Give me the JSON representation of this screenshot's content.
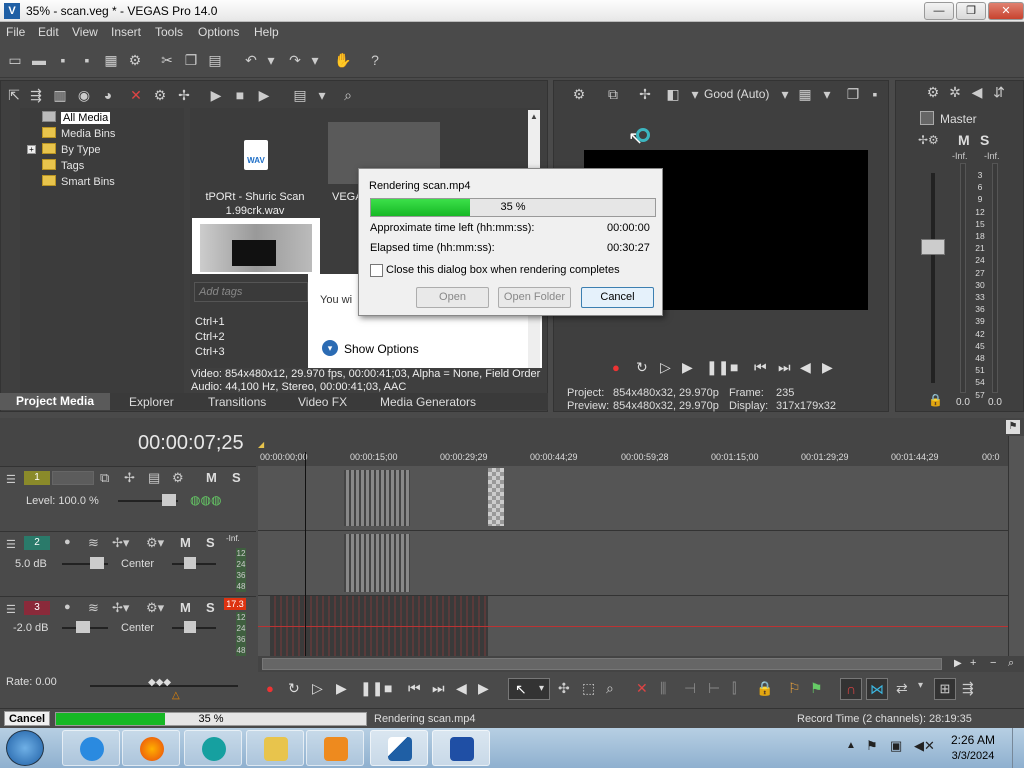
{
  "window": {
    "title": "35% - scan.veg * - VEGAS Pro 14.0",
    "min": "—",
    "max": "❐",
    "close": "✕"
  },
  "menu": [
    "File",
    "Edit",
    "View",
    "Insert",
    "Tools",
    "Options",
    "Help"
  ],
  "media_tree": [
    "All Media",
    "Media Bins",
    "By Type",
    "Tags",
    "Smart Bins"
  ],
  "media": {
    "file1_line1": "tPORt - Shuric Scan",
    "file1_line2": "1.99crk.wav",
    "file2_label": "VEGA",
    "wav_badge": "WAV",
    "tags_placeholder": "Add tags",
    "ctrl": [
      "Ctrl+1",
      "Ctrl+2",
      "Ctrl+3"
    ],
    "you_wi": "You wi",
    "show_options": "Show Options",
    "info_video": "Video: 854x480x12, 29.970 fps, 00:00:41;03, Alpha = None, Field Order",
    "info_audio": "Audio: 44,100 Hz, Stereo, 00:00:41;03, AAC"
  },
  "tabs": [
    "Project Media",
    "Explorer",
    "Transitions",
    "Video FX",
    "Media Generators"
  ],
  "dialog": {
    "title": "Rendering scan.mp4",
    "percent_label": "35 %",
    "progress": 0.35,
    "time_left_label": "Approximate time left (hh:mm:ss):",
    "time_left": "00:00:00",
    "elapsed_label": "Elapsed time (hh:mm:ss):",
    "elapsed": "00:30:27",
    "checkbox_label": "Close this dialog box when rendering completes",
    "open": "Open",
    "open_folder": "Open Folder",
    "cancel": "Cancel"
  },
  "preview": {
    "quality": "Good (Auto)",
    "project_label": "Project:",
    "project_val": "854x480x32, 29.970p",
    "preview_label": "Preview:",
    "preview_val": "854x480x32, 29.970p",
    "frame_label": "Frame:",
    "frame_val": "235",
    "display_label": "Display:",
    "display_val": "317x179x32"
  },
  "master": {
    "label": "Master",
    "m": "M",
    "s": "S",
    "inf_left": "-Inf.",
    "inf_right": "-Inf.",
    "scale": [
      "3",
      "6",
      "9",
      "12",
      "15",
      "18",
      "21",
      "24",
      "27",
      "30",
      "33",
      "36",
      "39",
      "42",
      "45",
      "48",
      "51",
      "54",
      "57"
    ],
    "val_left": "0.0",
    "val_right": "0.0"
  },
  "timeline": {
    "timecode": "00:00:07;25",
    "ruler": [
      "00:00:00;00",
      "00:00:15;00",
      "00:00:29;29",
      "00:00:44;29",
      "00:00:59;28",
      "00:01:15;00",
      "00:01:29;29",
      "00:01:44;29",
      "00:0"
    ],
    "tracks": [
      {
        "num": "1",
        "level": "Level: 100.0 %"
      },
      {
        "num": "2",
        "db": "5.0 dB",
        "pan": "Center",
        "meter_top": "-Inf."
      },
      {
        "num": "3",
        "db": "-2.0 dB",
        "pan": "Center",
        "meter_top": "17.3"
      }
    ],
    "meter_ticks": [
      "12",
      "24",
      "36",
      "48"
    ],
    "m": "M",
    "s": "S"
  },
  "rate": "Rate: 0.00",
  "status": {
    "cancel": "Cancel",
    "percent": "35 %",
    "progress": 0.35,
    "message": "Rendering scan.mp4",
    "record_time": "Record Time (2 channels): 28:19:35"
  },
  "taskbar": {
    "time": "2:26 AM",
    "date": "3/3/2024"
  },
  "colors": {
    "accent_green": "#16b825",
    "track1": "#8a8a2a",
    "track2": "#2a7a6a",
    "track3": "#8a2a3a"
  }
}
